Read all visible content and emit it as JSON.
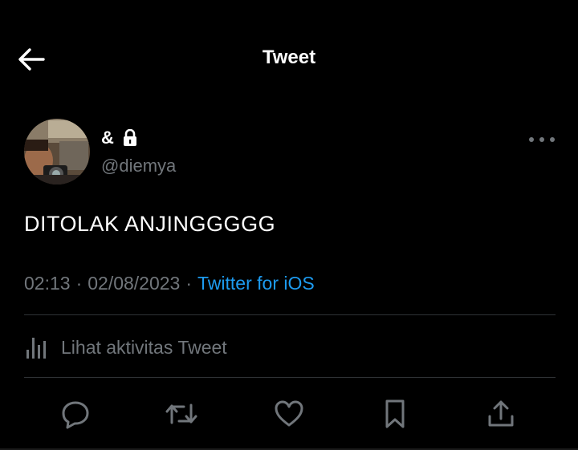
{
  "header": {
    "title": "Tweet",
    "back_icon": "arrow-left-icon"
  },
  "author": {
    "display_name": "&",
    "lock_icon": "lock-icon",
    "handle": "@diemya"
  },
  "tweet": {
    "text": "DITOLAK ANJINGGGGG",
    "time": "02:13",
    "separator": "·",
    "date": "02/08/2023",
    "source": "Twitter for iOS"
  },
  "activity": {
    "icon": "analytics-icon",
    "label": "Lihat aktivitas Tweet"
  },
  "actions": [
    "reply-icon",
    "retweet-icon",
    "like-icon",
    "bookmark-icon",
    "share-icon"
  ],
  "colors": {
    "background": "#000000",
    "accent": "#1d9bf0",
    "secondary_text": "#71767b",
    "divider": "#2f3336"
  }
}
